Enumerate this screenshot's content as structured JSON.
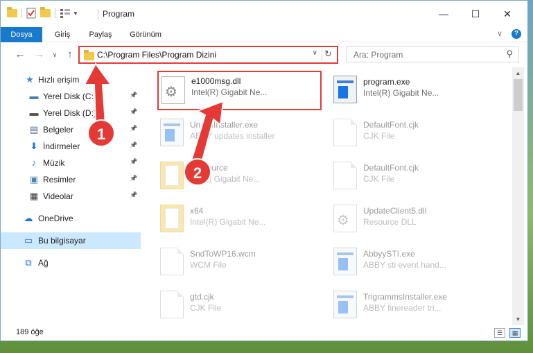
{
  "window": {
    "title": "Program",
    "controls": {
      "minimize": "—",
      "maximize": "☐",
      "close": "✕"
    }
  },
  "ribbon": {
    "tabs": [
      {
        "label": "Dosya"
      },
      {
        "label": "Giriş"
      },
      {
        "label": "Paylaş"
      },
      {
        "label": "Görünüm"
      }
    ],
    "collapse": "∨",
    "help": "?"
  },
  "navigation": {
    "back": "←",
    "forward": "→",
    "recent": "∨",
    "up": "↑",
    "address": "C:\\Program Files\\Program Dizini",
    "address_dropdown": "∨",
    "refresh": "↻",
    "search_placeholder": "Ara: Program",
    "search_icon": "⚲"
  },
  "sidebar": {
    "items": [
      {
        "label": "Hızlı erişim",
        "icon": "star-icon",
        "glyph": "★",
        "color": "#3b8ad6",
        "pinned": false
      },
      {
        "label": "Yerel Disk (C:)",
        "icon": "drive-icon",
        "glyph": "▬",
        "color": "#4a7fb5",
        "pinned": true
      },
      {
        "label": "Yerel Disk (D:)",
        "icon": "drive-icon",
        "glyph": "▬",
        "color": "#555555",
        "pinned": true
      },
      {
        "label": "Belgeler",
        "icon": "documents-icon",
        "glyph": "▤",
        "color": "#4a6a8a",
        "pinned": true
      },
      {
        "label": "İndirmeler",
        "icon": "download-icon",
        "glyph": "⬇",
        "color": "#1a73e8",
        "pinned": true
      },
      {
        "label": "Müzik",
        "icon": "music-icon",
        "glyph": "♪",
        "color": "#1a73e8",
        "pinned": true
      },
      {
        "label": "Resimler",
        "icon": "pictures-icon",
        "glyph": "▣",
        "color": "#4a7fb5",
        "pinned": true
      },
      {
        "label": "Videolar",
        "icon": "videos-icon",
        "glyph": "▦",
        "color": "#333333",
        "pinned": true
      },
      {
        "label": "OneDrive",
        "icon": "cloud-icon",
        "glyph": "☁",
        "color": "#1a73e8",
        "pinned": false
      },
      {
        "label": "Bu bilgisayar",
        "icon": "computer-icon",
        "glyph": "▭",
        "color": "#1a73e8",
        "pinned": false,
        "selected": true
      },
      {
        "label": "Ağ",
        "icon": "network-icon",
        "glyph": "⧉",
        "color": "#1a73e8",
        "pinned": false
      }
    ],
    "pin_glyph": "📌"
  },
  "files": [
    {
      "name": "e1000msg.dll",
      "desc": "Intel(R) Gigabit Ne...",
      "type": "gear",
      "icon": "dll-file-icon",
      "highlighted": true
    },
    {
      "name": "program.exe",
      "desc": "Intel(R) Gigabit Ne...",
      "type": "exe",
      "icon": "exe-file-icon"
    },
    {
      "name": "Un…eInstaller.exe",
      "desc": "ABBY updates installer",
      "type": "exe",
      "icon": "exe-file-icon"
    },
    {
      "name": "DefaultFont.cjk",
      "desc": "CJK File",
      "type": "doc",
      "icon": "file-icon"
    },
    {
      "name": "…esource",
      "desc": "…l(R) Gigabit Ne...",
      "type": "folder",
      "icon": "folder-icon"
    },
    {
      "name": "DefaultFont.cjk",
      "desc": "CJK File",
      "type": "doc",
      "icon": "file-icon"
    },
    {
      "name": "x64",
      "desc": "Intel(R) Gigabit Ne...",
      "type": "folder",
      "icon": "folder-icon"
    },
    {
      "name": "UpdateClient5.dll",
      "desc": "Resource DLL",
      "type": "gear",
      "icon": "dll-file-icon"
    },
    {
      "name": "SndToWP16.wcm",
      "desc": "WCM File",
      "type": "doc",
      "icon": "file-icon"
    },
    {
      "name": "AbbyySTI.exe",
      "desc": "ABBY sti event hand...",
      "type": "exe",
      "icon": "exe-file-icon"
    },
    {
      "name": "gtd.cjk",
      "desc": "CJK File",
      "type": "doc",
      "icon": "file-icon"
    },
    {
      "name": "TrigrammsInstaller.exe",
      "desc": "ABBY finereader tri...",
      "type": "exe",
      "icon": "exe-file-icon"
    }
  ],
  "scrollbar": {
    "up": "▲",
    "down": "▼"
  },
  "status": {
    "count": "189 öğe",
    "details_view": "☰",
    "icons_view": "▦"
  },
  "annotations": [
    {
      "label": "1"
    },
    {
      "label": "2"
    }
  ],
  "colors": {
    "accent": "#1979ca",
    "highlight": "#e53935",
    "selection": "#cce8ff"
  }
}
